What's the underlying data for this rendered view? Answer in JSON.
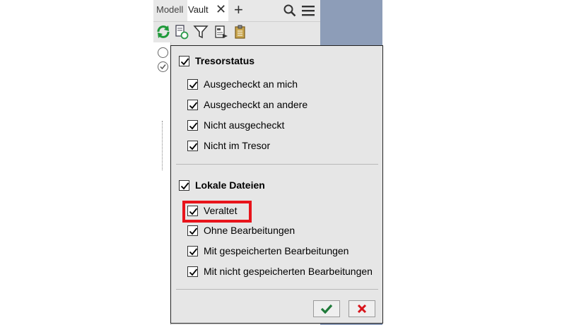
{
  "tabs": {
    "modell": "Modell",
    "vault": "Vault",
    "close_glyph": "✕",
    "add_glyph": "+"
  },
  "toolbar": {
    "icons": [
      "refresh-icon",
      "document-refresh-icon",
      "filter-icon",
      "report-icon",
      "clipboard-icon"
    ]
  },
  "filter": {
    "tresor": {
      "header": "Tresorstatus",
      "checked": true,
      "items": [
        {
          "label": "Ausgecheckt an mich",
          "checked": true
        },
        {
          "label": "Ausgecheckt an andere",
          "checked": true
        },
        {
          "label": "Nicht ausgecheckt",
          "checked": true
        },
        {
          "label": "Nicht im Tresor",
          "checked": true
        }
      ]
    },
    "lokal": {
      "header": "Lokale Dateien",
      "checked": true,
      "items": [
        {
          "label": "Veraltet",
          "checked": true,
          "highlighted": true
        },
        {
          "label": "Ohne Bearbeitungen",
          "checked": true
        },
        {
          "label": "Mit gespeicherten Bearbeitungen",
          "checked": true
        },
        {
          "label": "Mit nicht gespeicherten Bearbeitungen",
          "checked": true
        }
      ]
    }
  },
  "colors": {
    "ok": "#1f7a3a",
    "cancel": "#d8141b",
    "highlight": "#e8141b",
    "side_panel": "#8d9db8"
  }
}
